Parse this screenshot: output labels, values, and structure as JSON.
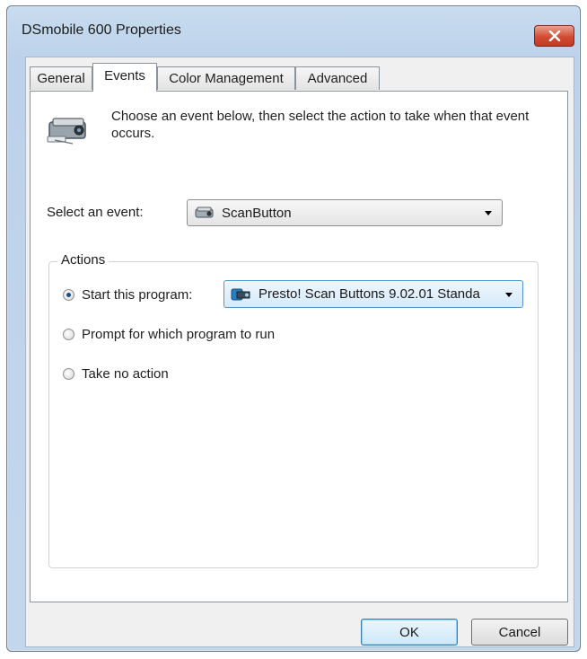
{
  "window": {
    "title": "DSmobile 600 Properties",
    "close_icon": "close-icon"
  },
  "tabs": [
    {
      "label": "General",
      "active": false
    },
    {
      "label": "Events",
      "active": true
    },
    {
      "label": "Color Management",
      "active": false
    },
    {
      "label": "Advanced",
      "active": false
    }
  ],
  "panel": {
    "intro_icon": "scanner-icon",
    "intro_text": "Choose an event below, then select the action to take when that event occurs.",
    "event_label": "Select an event:",
    "event_dropdown": {
      "icon": "scanner-icon",
      "value": "ScanButton"
    },
    "actions": {
      "legend": "Actions",
      "options": [
        {
          "label": "Start this program:",
          "checked": true
        },
        {
          "label": "Prompt for which program to run",
          "checked": false
        },
        {
          "label": "Take no action",
          "checked": false
        }
      ],
      "program_dropdown": {
        "icon": "presto-app-icon",
        "value": "Presto! Scan Buttons 9.02.01 Standa"
      }
    }
  },
  "buttons": {
    "ok": "OK",
    "cancel": "Cancel"
  },
  "colors": {
    "titlebar": "#c9dcef",
    "close_button": "#d24b34",
    "focus_border": "#4f9ad6"
  }
}
